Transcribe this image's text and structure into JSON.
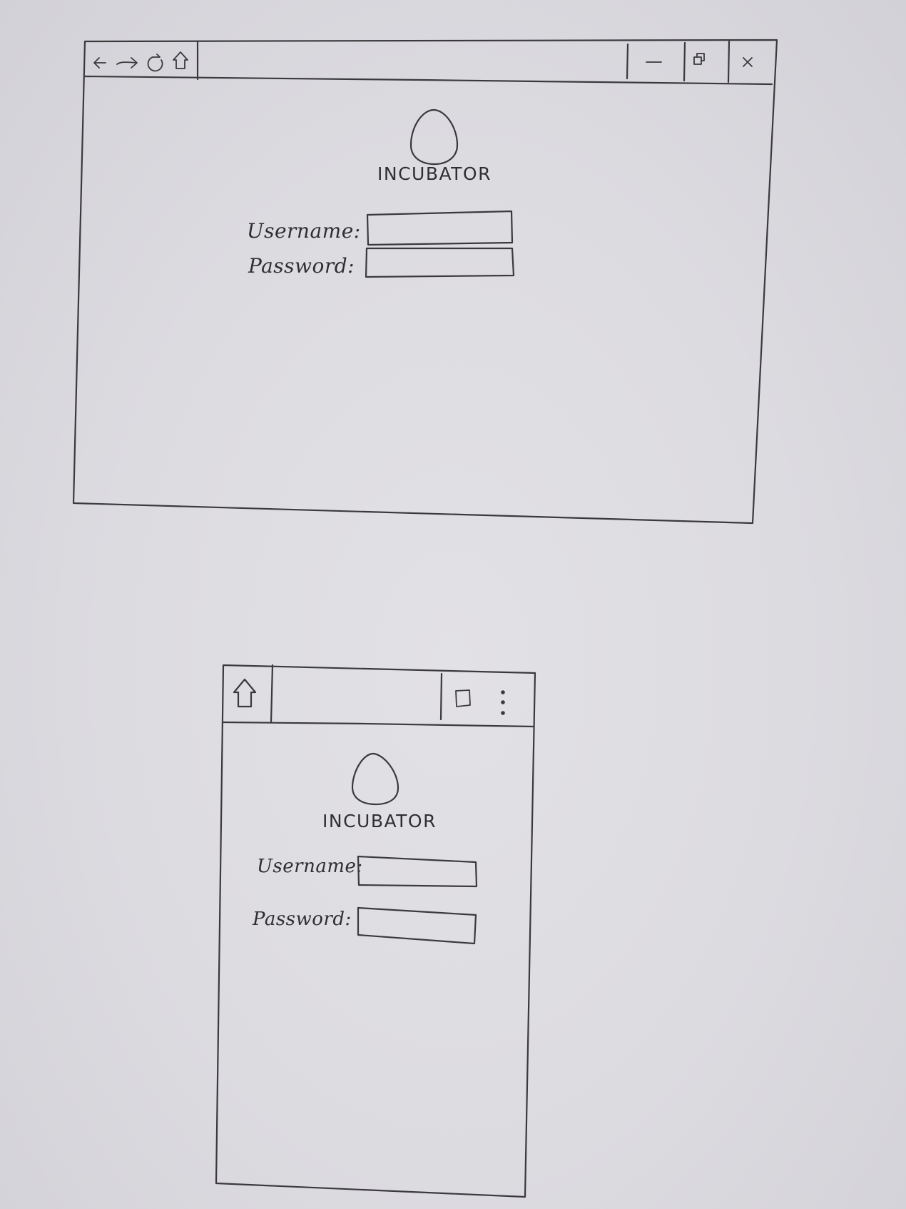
{
  "desktop": {
    "window_controls": [
      "minimize-icon",
      "restore-icon",
      "close-icon"
    ],
    "nav_icons": [
      "back-arrow-icon",
      "forward-arrow-icon",
      "reload-icon",
      "home-icon"
    ],
    "logo": {
      "icon": "egg-icon",
      "title": "INCUBATOR"
    },
    "form": {
      "username_label": "Username:",
      "username_value": "",
      "password_label": "Password:",
      "password_value": ""
    }
  },
  "mobile": {
    "toolbar_icons": [
      "home-icon",
      "tabs-icon",
      "overflow-menu-icon"
    ],
    "logo": {
      "icon": "egg-icon",
      "title": "INCUBATOR"
    },
    "form": {
      "username_label": "Username:",
      "username_value": "",
      "password_label": "Password:",
      "password_value": ""
    }
  },
  "colors": {
    "paper": "#dfdee3",
    "pencil": "#3a3a3d"
  }
}
